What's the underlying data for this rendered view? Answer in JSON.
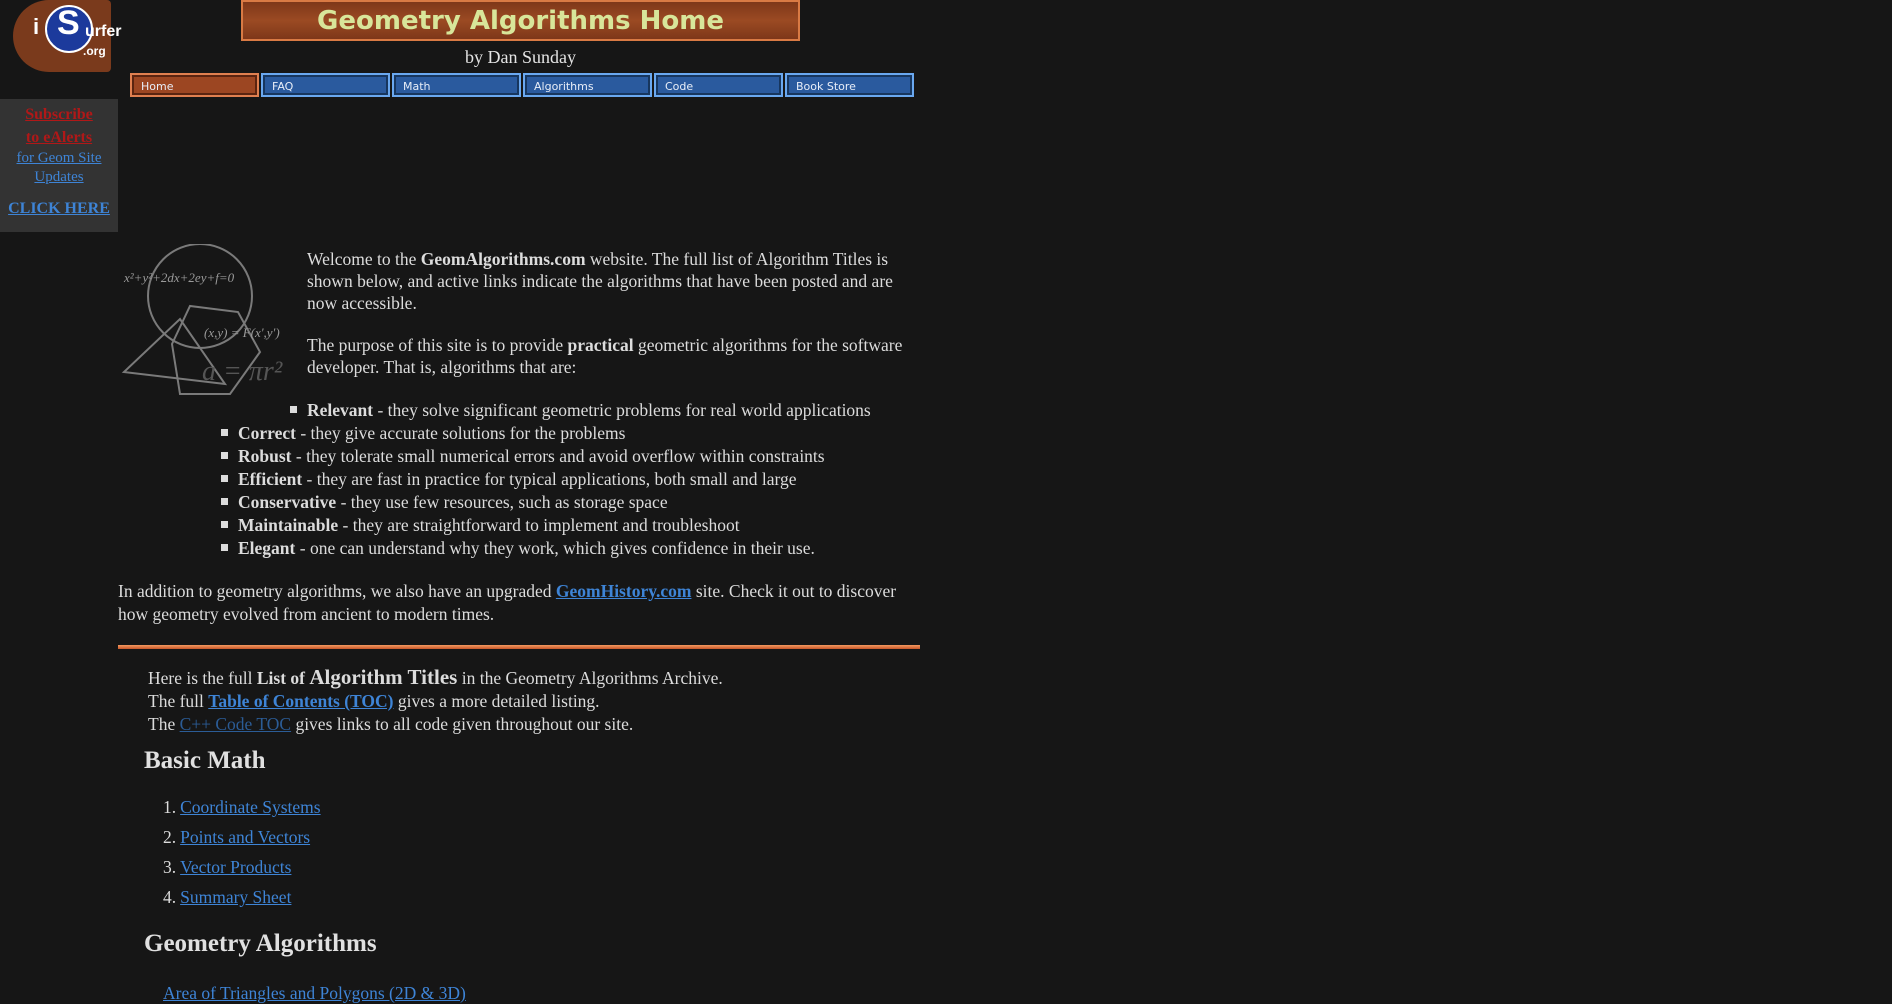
{
  "logo": {
    "i": "i",
    "s": "S",
    "urfer": "urfer",
    "org": ".org"
  },
  "header": {
    "title": "Geometry Algorithms Home",
    "byline": "by Dan Sunday"
  },
  "nav": [
    {
      "label": "Home",
      "active": true
    },
    {
      "label": "FAQ"
    },
    {
      "label": "Math"
    },
    {
      "label": "Algorithms"
    },
    {
      "label": "Code"
    },
    {
      "label": "Book Store"
    }
  ],
  "sidebar": {
    "line1": "Subscribe",
    "line2": "to eAlerts",
    "line3": "for Geom Site",
    "line4": "Updates",
    "click": "CLICK HERE"
  },
  "illustration": {
    "equation1": "x²+y²+2dx+2ey+f=0",
    "equation2": "(x,y) = F(x',y')",
    "equation3": "a = πr²"
  },
  "intro": {
    "p1_pre": "Welcome to the ",
    "p1_bold": "GeomAlgorithms.com",
    "p1_post": " website. The full list of Algorithm Titles is shown below, and active links indicate the algorithms that have been posted and are now accessible.",
    "p2_pre": "The purpose of this site is to provide ",
    "p2_bold": "practical",
    "p2_post": " geometric algorithms for the software developer. That is, algorithms that are:"
  },
  "qualities": [
    {
      "term": "Relevant",
      "desc": " - they solve significant geometric problems for real world applications"
    },
    {
      "term": "Correct",
      "desc": " - they give accurate solutions for the problems"
    },
    {
      "term": "Robust",
      "desc": " - they tolerate small numerical errors and avoid overflow within constraints"
    },
    {
      "term": "Efficient",
      "desc": " - they are fast in practice for typical applications, both small and large"
    },
    {
      "term": "Conservative",
      "desc": " - they use few resources, such as storage space"
    },
    {
      "term": "Maintainable",
      "desc": " - they are straightforward to implement and troubleshoot"
    },
    {
      "term": "Elegant",
      "desc": " - one can understand why they work, which gives confidence in their use."
    }
  ],
  "addition": {
    "pre": "In addition to geometry algorithms, we also have an upgraded ",
    "link": "GeomHistory.com",
    "post": " site. Check it out to discover how geometry evolved from ancient to modern times."
  },
  "list_intro": {
    "l1_pre": "Here is the full ",
    "l1_bold1": "List of ",
    "l1_big": "Algorithm Titles",
    "l1_post": " in the Geometry Algorithms Archive.",
    "l2_pre": "The full ",
    "l2_link": "Table of Contents (TOC)",
    "l2_post": " gives a more detailed listing.",
    "l3_pre": "The ",
    "l3_link": "C++ Code TOC",
    "l3_post": " gives links to all code given throughout our site."
  },
  "basic_math": {
    "heading": "Basic Math",
    "items": [
      {
        "num": "1.",
        "label": "Coordinate Systems"
      },
      {
        "num": "2.",
        "label": "Points and Vectors"
      },
      {
        "num": "3.",
        "label": "Vector Products"
      },
      {
        "num": "4.",
        "label": "Summary Sheet"
      }
    ]
  },
  "geometry_algorithms": {
    "heading": "Geometry Algorithms",
    "first_item_partial": "Area of Triangles and Polygons (2D & 3D)"
  },
  "colors": {
    "background": "#161616",
    "title_bg": "#8a3e1e",
    "title_text": "#d8e69a",
    "nav_blue": "#2a5a9e",
    "nav_active": "#9c4622",
    "link": "#3e84d6"
  }
}
